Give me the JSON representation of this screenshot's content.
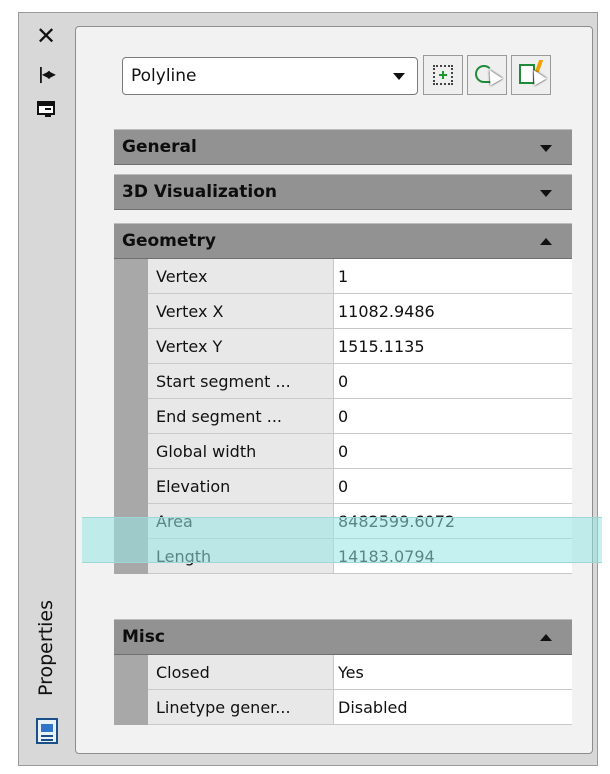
{
  "palette": {
    "title": "Properties",
    "object_type": "Polyline"
  },
  "toolbar": {
    "icons": [
      "pick-add-icon",
      "select-objects-icon",
      "quick-select-icon"
    ]
  },
  "sections": {
    "general": "General",
    "visualization": "3D Visualization",
    "geometry": "Geometry",
    "misc": "Misc"
  },
  "geometry": {
    "rows": [
      {
        "name": "Vertex",
        "value": "1"
      },
      {
        "name": "Vertex X",
        "value": "11082.9486"
      },
      {
        "name": "Vertex Y",
        "value": "1515.1135"
      },
      {
        "name": "Start segment ...",
        "value": "0"
      },
      {
        "name": "End segment ...",
        "value": "0"
      },
      {
        "name": "Global width",
        "value": "0"
      },
      {
        "name": "Elevation",
        "value": "0"
      },
      {
        "name": "Area",
        "value": "8482599.6072"
      },
      {
        "name": "Length",
        "value": "14183.0794"
      }
    ]
  },
  "misc": {
    "rows": [
      {
        "name": "Closed",
        "value": "Yes"
      },
      {
        "name": "Linetype gener...",
        "value": "Disabled"
      }
    ]
  },
  "highlight_color": "#96e6e4"
}
